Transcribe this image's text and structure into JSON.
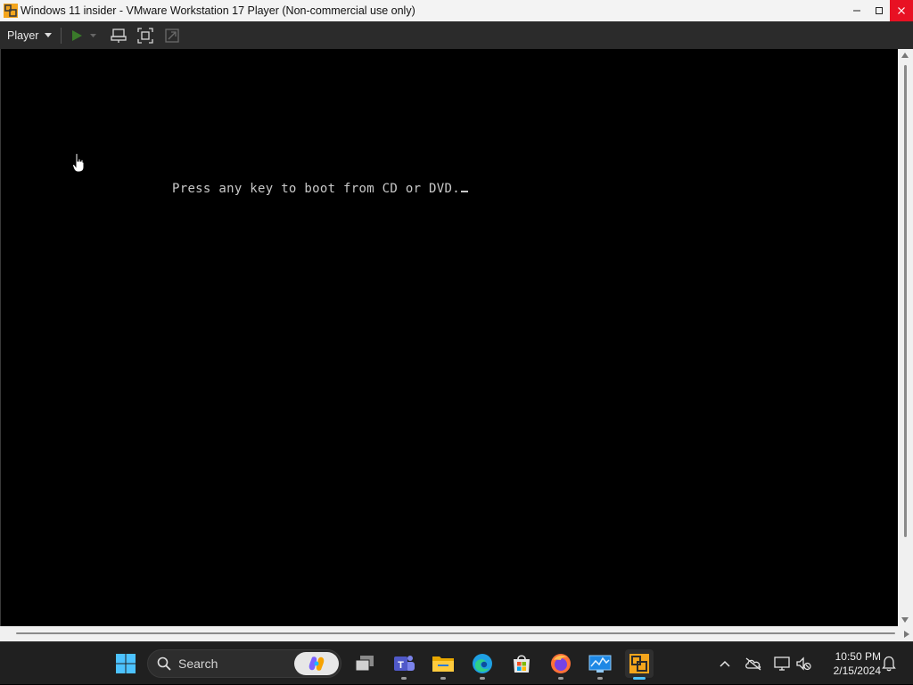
{
  "window": {
    "title": "Windows 11 insider - VMware Workstation 17 Player (Non-commercial use only)",
    "controls": {
      "minimize": "—",
      "maximize": "☐",
      "close": "✕"
    }
  },
  "toolbar": {
    "player_label": "Player",
    "icons": [
      "play-icon",
      "send-ctrl-alt-del-icon",
      "full-screen-icon",
      "unity-icon"
    ]
  },
  "vm_screen": {
    "boot_message": "Press any key to boot from CD or DVD."
  },
  "taskbar": {
    "search_label": "Search",
    "apps": [
      "windows-start-icon",
      "task-view-icon",
      "teams-icon",
      "file-explorer-icon",
      "edge-icon",
      "microsoft-store-icon",
      "firefox-icon",
      "resource-monitor-icon",
      "vmware-player-icon"
    ],
    "tray_icons": [
      "chevron-up-icon",
      "onedrive-offline-icon",
      "display-icon",
      "volume-muted-icon",
      "notification-bell-icon"
    ],
    "time": "10:50 PM",
    "date": "2/15/2024"
  },
  "colors": {
    "taskbar_bg": "#202020",
    "toolbar_bg": "#2b2b2b",
    "close_button": "#e81123",
    "active_indicator": "#4cc2ff"
  }
}
